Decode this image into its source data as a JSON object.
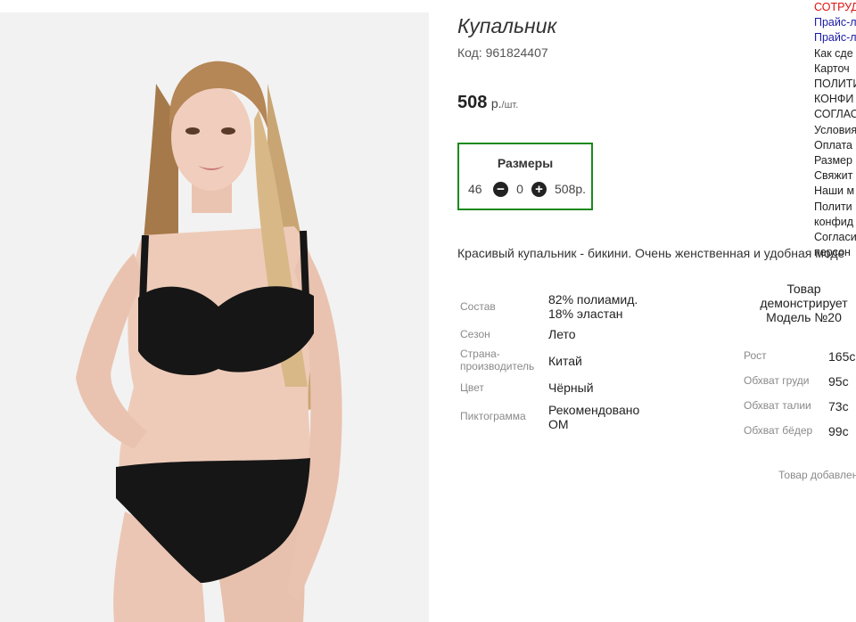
{
  "product": {
    "title": "Купальник",
    "code": "Код: 961824407",
    "price": "508",
    "currency": "р.",
    "unit": "/шт.",
    "description": "Красивый купальник - бикини. Очень женственная и удобная моде"
  },
  "sizes": {
    "title": "Размеры",
    "size": "46",
    "quantity": "0",
    "line_total": "508р.",
    "minus_icon": "minus-circle",
    "plus_icon": "plus-circle"
  },
  "specs": [
    {
      "label": "Состав",
      "value": "82% полиамид.\n18% эластан"
    },
    {
      "label": "Сезон",
      "value": "Лето"
    },
    {
      "label": "Страна-\nпроизводитель",
      "value": "Китай"
    },
    {
      "label": "Цвет",
      "value": "Чёрный"
    },
    {
      "label": "Пиктограмма",
      "value": "Рекомендовано\nОМ"
    }
  ],
  "model": {
    "title": "Товар демонстрирует Модель №20",
    "rows": [
      {
        "label": "Рост",
        "value": "165с"
      },
      {
        "label": "Обхват груди",
        "value": "95с"
      },
      {
        "label": "Обхват талии",
        "value": "73с"
      },
      {
        "label": "Обхват бёдер",
        "value": "99с"
      }
    ]
  },
  "added_text": "Товар добавлен",
  "sidebar_links": [
    {
      "text": "СОТРУД",
      "color": "#e01010"
    },
    {
      "text": "Прайс-л",
      "color": "#1a1aa8"
    },
    {
      "text": "Прайс-л",
      "color": "#1a1aa8"
    },
    {
      "text": "Как сде",
      "color": "#222222"
    },
    {
      "text": "Карточ",
      "color": "#222222"
    },
    {
      "text": "ПОЛИТИ",
      "color": "#222222"
    },
    {
      "text": "КОНФИ",
      "color": "#222222"
    },
    {
      "text": "СОГЛАС",
      "color": "#222222"
    },
    {
      "text": "Условия",
      "color": "#222222"
    },
    {
      "text": "Оплата",
      "color": "#222222"
    },
    {
      "text": "Размер",
      "color": "#222222"
    },
    {
      "text": "Свяжит",
      "color": "#222222"
    },
    {
      "text": "Наши м",
      "color": "#222222"
    },
    {
      "text": "Полити",
      "color": "#222222"
    },
    {
      "text": "конфид",
      "color": "#222222"
    },
    {
      "text": "Согласи",
      "color": "#222222"
    },
    {
      "text": "персон",
      "color": "#222222"
    }
  ],
  "colors": {
    "sizes_border": "#1a8a1a",
    "sidebar_red": "#e01010",
    "sidebar_blue": "#1a1aa8"
  }
}
